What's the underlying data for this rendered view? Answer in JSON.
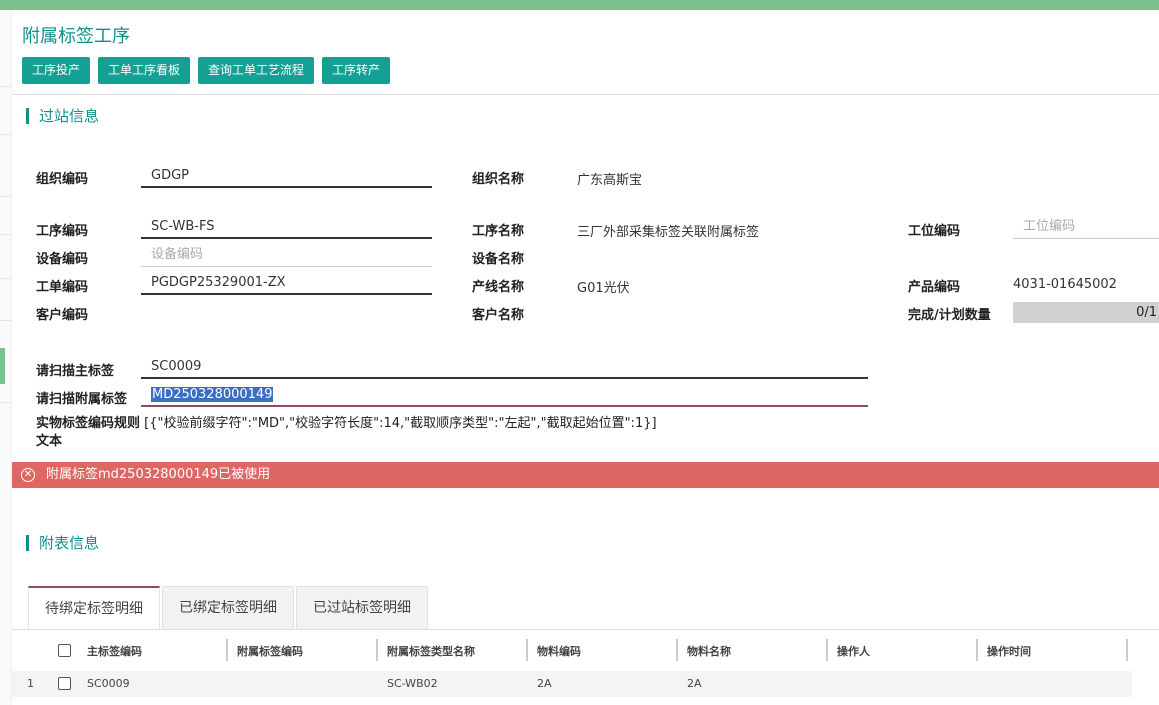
{
  "page": {
    "title": "附属标签工序"
  },
  "toolbar": {
    "buttons": [
      "工序投产",
      "工单工序看板",
      "查询工单工艺流程",
      "工序转产"
    ]
  },
  "section_station": {
    "title": "过站信息"
  },
  "fields": {
    "org_code_label": "组织编码",
    "org_code_value": "GDGP",
    "org_name_label": "组织名称",
    "org_name_value": "广东高斯宝",
    "proc_code_label": "工序编码",
    "proc_code_value": "SC-WB-FS",
    "proc_name_label": "工序名称",
    "proc_name_value": "三厂外部采集标签关联附属标签",
    "station_code_label": "工位编码",
    "station_code_placeholder": "工位编码",
    "device_code_label": "设备编码",
    "device_code_placeholder": "设备编码",
    "device_name_label": "设备名称",
    "wo_code_label": "工单编码",
    "wo_code_value": "PGDGP25329001-ZX",
    "line_name_label": "产线名称",
    "line_name_value": "G01光伏",
    "product_code_label": "产品编码",
    "product_code_value": "4031-01645002",
    "customer_code_label": "客户编码",
    "customer_name_label": "客户名称",
    "qty_label": "完成/计划数量",
    "qty_value": "0/1"
  },
  "scan": {
    "main_label": "请扫描主标签",
    "main_value": "SC0009",
    "sub_label": "请扫描附属标签",
    "sub_value": "MD250328000149"
  },
  "rule": {
    "label_line1": "实物标签编码规则",
    "label_line2": "文本",
    "value": "[{\"校验前缀字符\":\"MD\",\"校验字符长度\":14,\"截取顺序类型\":\"左起\",\"截取起始位置\":1}]"
  },
  "alert": {
    "message": "附属标签md250328000149已被使用",
    "color": "#de6663"
  },
  "section_attach": {
    "title": "附表信息"
  },
  "tabs": [
    "待绑定标签明细",
    "已绑定标签明细",
    "已过站标签明细"
  ],
  "table": {
    "columns": [
      "主标签编码",
      "附属标签编码",
      "附属标签类型名称",
      "物料编码",
      "物料名称",
      "操作人",
      "操作时间"
    ],
    "rows": [
      {
        "index": "1",
        "main": "SC0009",
        "sub": "",
        "type": "SC-WB02",
        "material_code": "2A",
        "material_name": "2A",
        "operator": "",
        "time": ""
      }
    ]
  },
  "colors": {
    "accent": "#11908a",
    "button": "#14a094",
    "topbar": "#7cc08d"
  }
}
